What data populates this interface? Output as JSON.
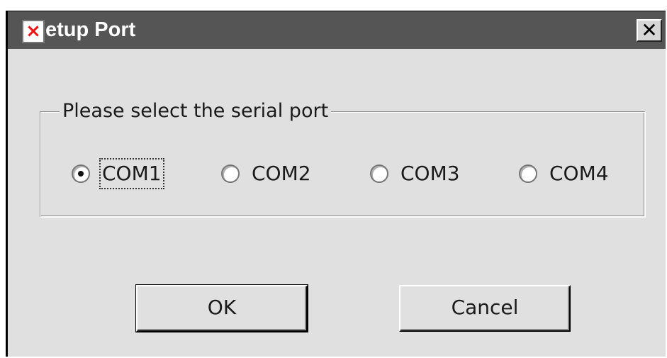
{
  "window": {
    "title": "etup Port",
    "app_icon": "error-x-icon",
    "close_icon": "close-x-icon",
    "close_glyph": "✕"
  },
  "group": {
    "legend": "Please select the serial port",
    "options": [
      {
        "label": "COM1",
        "selected": true
      },
      {
        "label": "COM2",
        "selected": false
      },
      {
        "label": "COM3",
        "selected": false
      },
      {
        "label": "COM4",
        "selected": false
      }
    ]
  },
  "buttons": {
    "ok_label": "OK",
    "cancel_label": "Cancel"
  },
  "colors": {
    "titlebar": "#555555",
    "dialog_background": "#e0e0e0",
    "app_icon_mark": "#ee1111"
  }
}
